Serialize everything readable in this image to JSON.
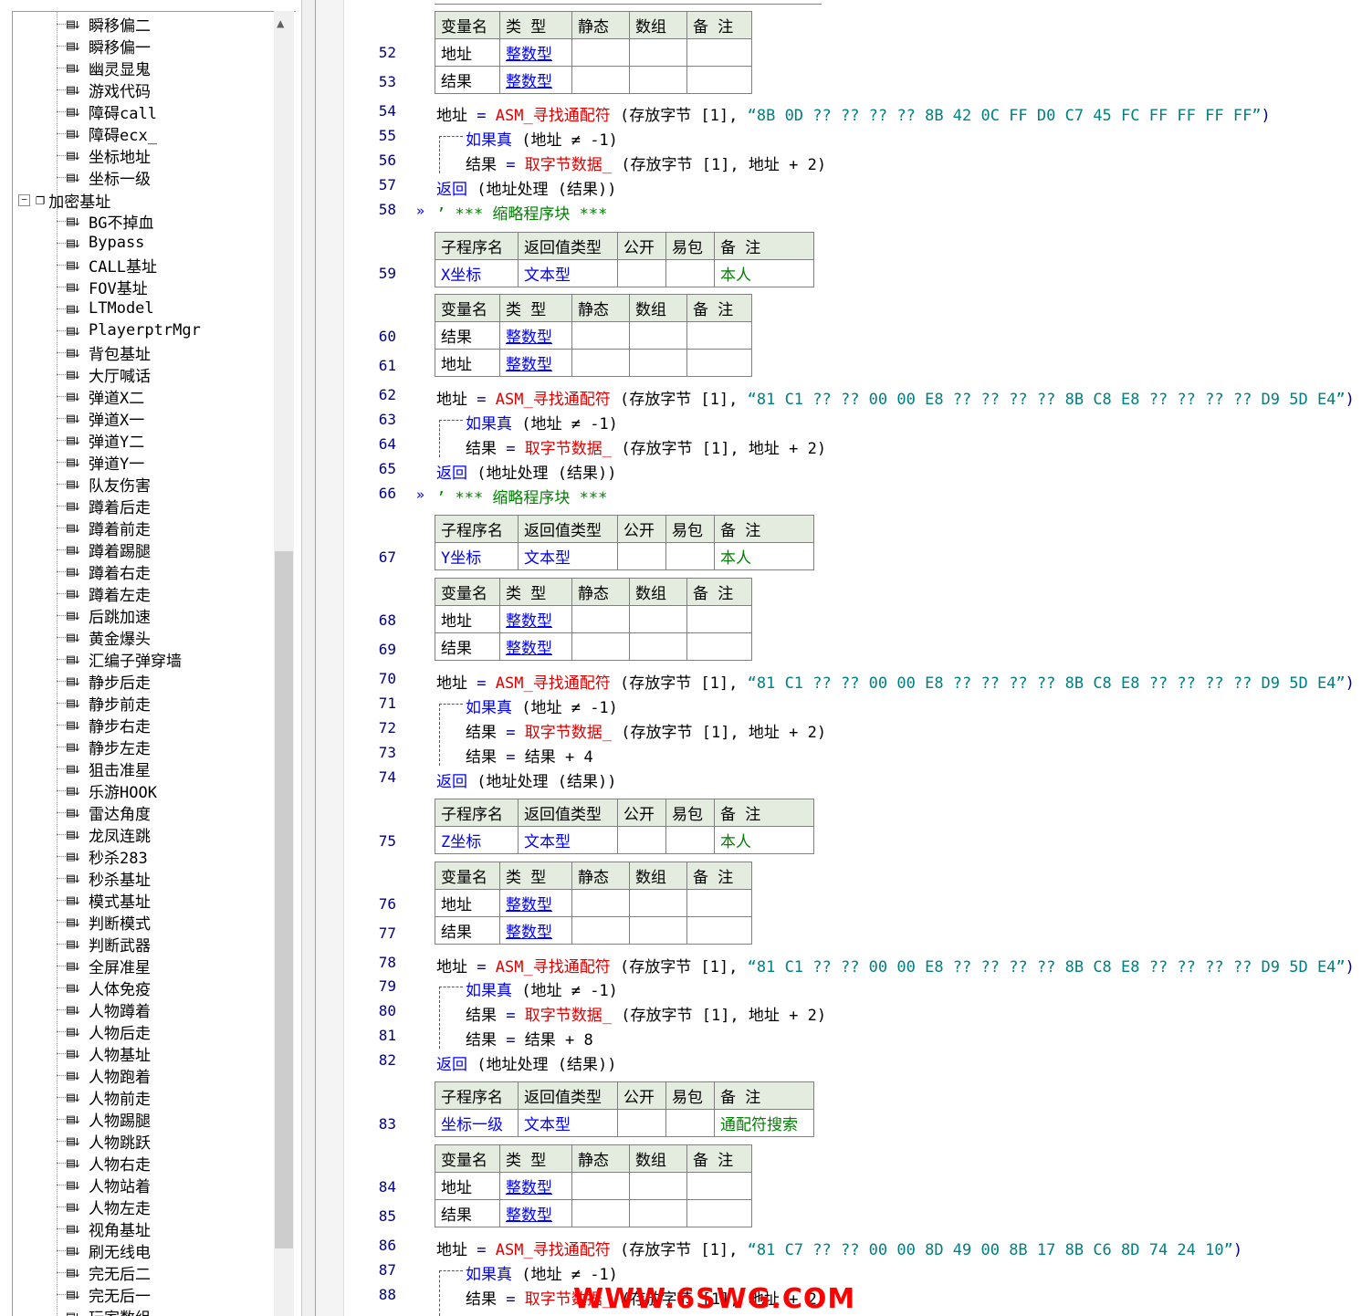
{
  "tree": {
    "items": [
      "瞬移偏二",
      "瞬移偏一",
      "幽灵显鬼",
      "游戏代码",
      "障碍call",
      "障碍ecx_",
      "坐标地址",
      "坐标一级"
    ],
    "folder": "加密基址",
    "folder_items": [
      "BG不掉血",
      "Bypass",
      "CALL基址",
      "FOV基址",
      "LTModel",
      "PlayerptrMgr",
      "背包基址",
      "大厅喊话",
      "弹道X二",
      "弹道X一",
      "弹道Y二",
      "弹道Y一",
      "队友伤害",
      "蹲着后走",
      "蹲着前走",
      "蹲着踢腿",
      "蹲着右走",
      "蹲着左走",
      "后跳加速",
      "黄金爆头",
      "汇编子弹穿墙",
      "静步后走",
      "静步前走",
      "静步右走",
      "静步左走",
      "狙击准星",
      "乐游HOOK",
      "雷达角度",
      "龙凤连跳",
      "秒杀283",
      "秒杀基址",
      "模式基址",
      "判断模式",
      "判断武器",
      "全屏准星",
      "人体免疫",
      "人物蹲着",
      "人物后走",
      "人物基址",
      "人物跑着",
      "人物前走",
      "人物踢腿",
      "人物跳跃",
      "人物右走",
      "人物站着",
      "人物左走",
      "视角基址",
      "刷无线电",
      "完无后二",
      "完无后一",
      "玩家数组"
    ],
    "item_icon": "routine-icon",
    "folder_icon": "module-icon"
  },
  "code": {
    "var_header": [
      "变量名",
      "类 型",
      "静态",
      "数组",
      "备 注"
    ],
    "sub_header": [
      "子程序名",
      "返回值类型",
      "公开",
      "易包",
      "备 注"
    ],
    "type_int": "整数型",
    "type_text": "文本型",
    "v_addr": "地址",
    "v_result": "结果",
    "fold_text": "’ *** 缩略程序块 ***",
    "subs": [
      {
        "name": "X坐标",
        "ret": "文本型",
        "note": "本人",
        "line": "59"
      },
      {
        "name": "Y坐标",
        "ret": "文本型",
        "note": "本人",
        "line": "67"
      },
      {
        "name": "Z坐标",
        "ret": "文本型",
        "note": "本人",
        "line": "75"
      },
      {
        "name": "坐标一级",
        "ret": "文本型",
        "note": "通配符搜索",
        "line": "83"
      }
    ],
    "lines": {
      "52": "52",
      "53": "53",
      "54": "54",
      "55": "55",
      "56": "56",
      "57": "57",
      "58": "58",
      "60": "60",
      "61": "61",
      "62": "62",
      "63": "63",
      "64": "64",
      "65": "65",
      "66": "66",
      "68": "68",
      "69": "69",
      "70": "70",
      "71": "71",
      "72": "72",
      "73": "73",
      "74": "74",
      "76": "76",
      "77": "77",
      "78": "78",
      "79": "79",
      "80": "80",
      "81": "81",
      "82": "82",
      "84": "84",
      "85": "85",
      "86": "86",
      "87": "87",
      "88": "88"
    },
    "asm_call": "ASM_寻找通配符",
    "store_byte": "(存放字节 [1],",
    "pattern1": "“8B 0D ?? ?? ?? ?? 8B 42 0C FF D0 C7 45 FC FF FF FF FF”",
    "pattern2": "“81 C1 ?? ?? 00 00 E8 ?? ?? ?? ?? 8B C8 E8 ?? ?? ?? ?? D9 5D E4”",
    "pattern3": "“81 C7 ?? ?? 00 00 8D 49 00 8B 17 8B C6 8D 74 24 10”",
    "if_true": "如果真",
    "cond": "(地址 ≠ -1)",
    "get_bytes": "取字节数据_",
    "args_tail": "地址 + 2)",
    "return_kw": "返回",
    "return_arg": "(地址处理 (结果))",
    "plus4": "结果 + 4",
    "plus8": "结果 + 8"
  },
  "watermark": "WWW.6SWG.COM"
}
